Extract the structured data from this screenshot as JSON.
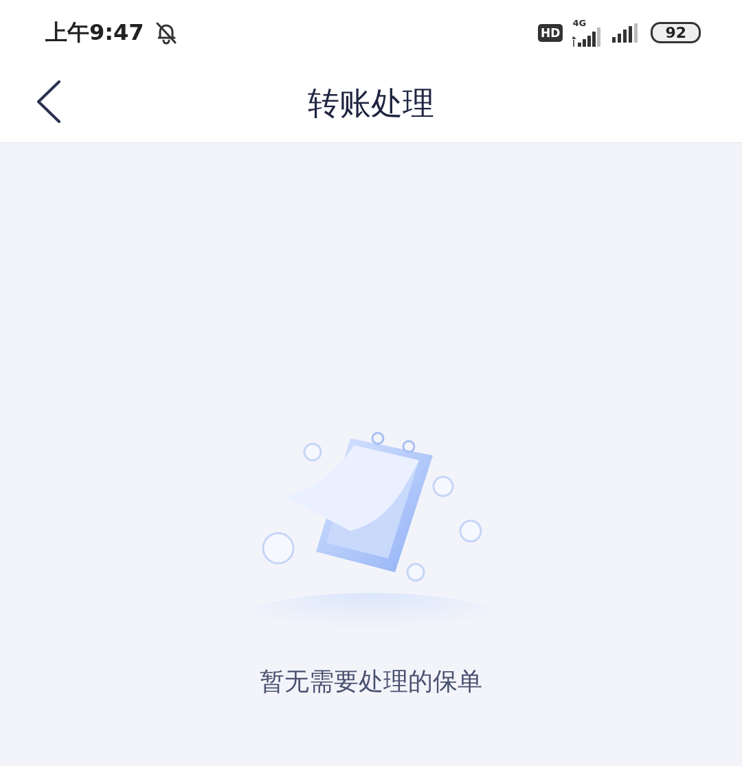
{
  "status_bar": {
    "time": "上午9:47",
    "hd": "HD",
    "network": "4G",
    "battery": "92"
  },
  "header": {
    "title": "转账处理"
  },
  "empty_state": {
    "message": "暂无需要处理的保单"
  }
}
